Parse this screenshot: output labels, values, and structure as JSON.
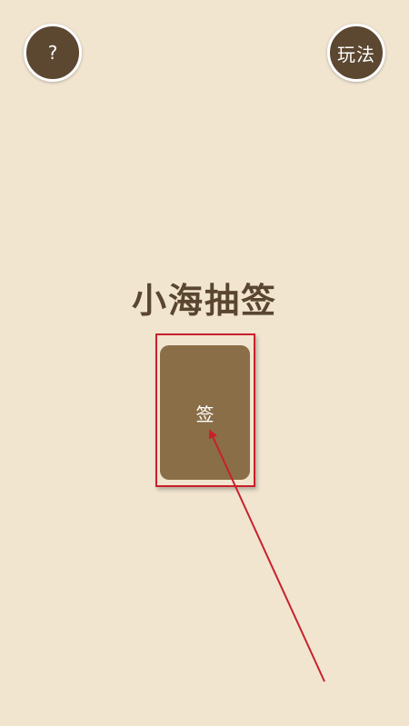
{
  "header": {
    "help_label": "?",
    "rules_label": "玩法"
  },
  "main": {
    "title": "小海抽签",
    "card_label": "签"
  },
  "colors": {
    "background": "#f1e5d0",
    "button_fill": "#5c4731",
    "card_fill": "#8a6e48",
    "title_text": "#5a4630",
    "annotation_red": "#c8202a"
  }
}
